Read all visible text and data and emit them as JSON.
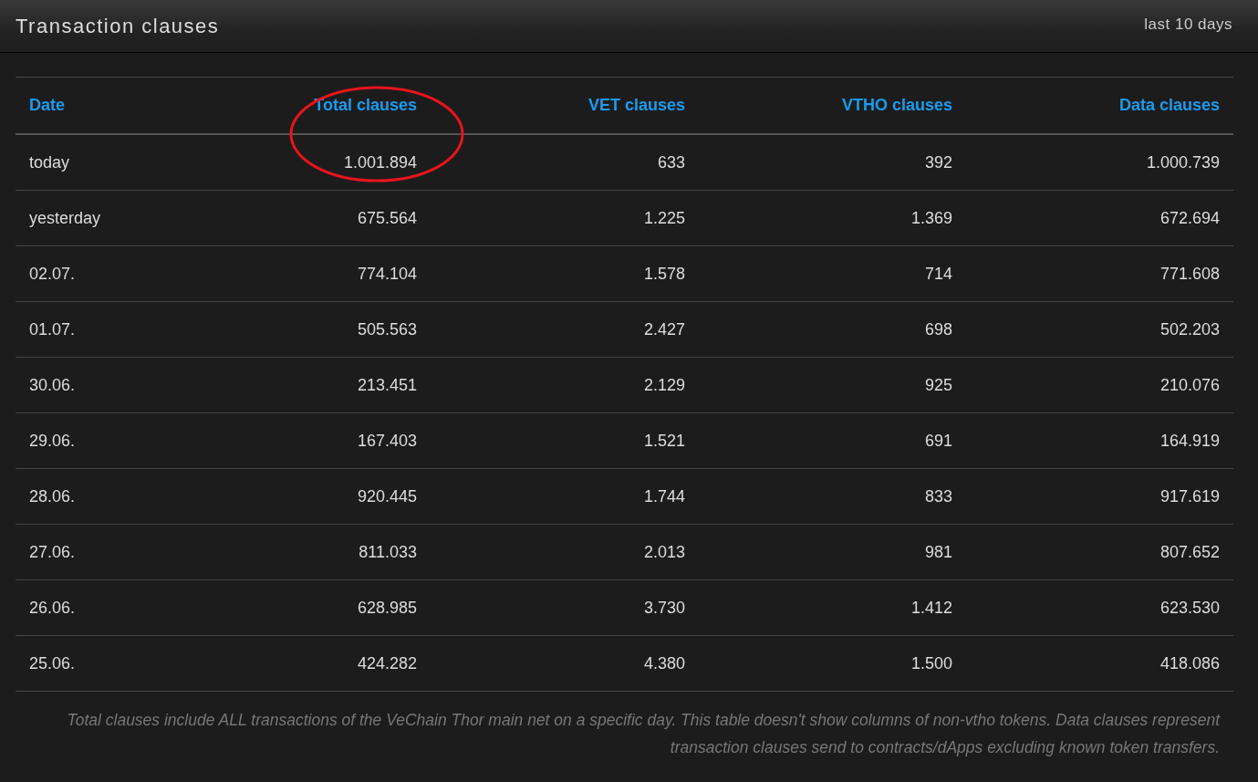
{
  "header": {
    "title": "Transaction clauses",
    "period": "last 10 days"
  },
  "table": {
    "columns": [
      "Date",
      "Total clauses",
      "VET clauses",
      "VTHO clauses",
      "Data clauses"
    ],
    "rows": [
      [
        "today",
        "1.001.894",
        "633",
        "392",
        "1.000.739"
      ],
      [
        "yesterday",
        "675.564",
        "1.225",
        "1.369",
        "672.694"
      ],
      [
        "02.07.",
        "774.104",
        "1.578",
        "714",
        "771.608"
      ],
      [
        "01.07.",
        "505.563",
        "2.427",
        "698",
        "502.203"
      ],
      [
        "30.06.",
        "213.451",
        "2.129",
        "925",
        "210.076"
      ],
      [
        "29.06.",
        "167.403",
        "1.521",
        "691",
        "164.919"
      ],
      [
        "28.06.",
        "920.445",
        "1.744",
        "833",
        "917.619"
      ],
      [
        "27.06.",
        "811.033",
        "2.013",
        "981",
        "807.652"
      ],
      [
        "26.06.",
        "628.985",
        "3.730",
        "1.412",
        "623.530"
      ],
      [
        "25.06.",
        "424.282",
        "4.380",
        "1.500",
        "418.086"
      ]
    ]
  },
  "footnote": "Total clauses include ALL transactions of the VeChain Thor main net on a specific day. This table doesn't show columns of non-vtho tokens. Data clauses represent transaction clauses send to contracts/dApps excluding known token transfers."
}
